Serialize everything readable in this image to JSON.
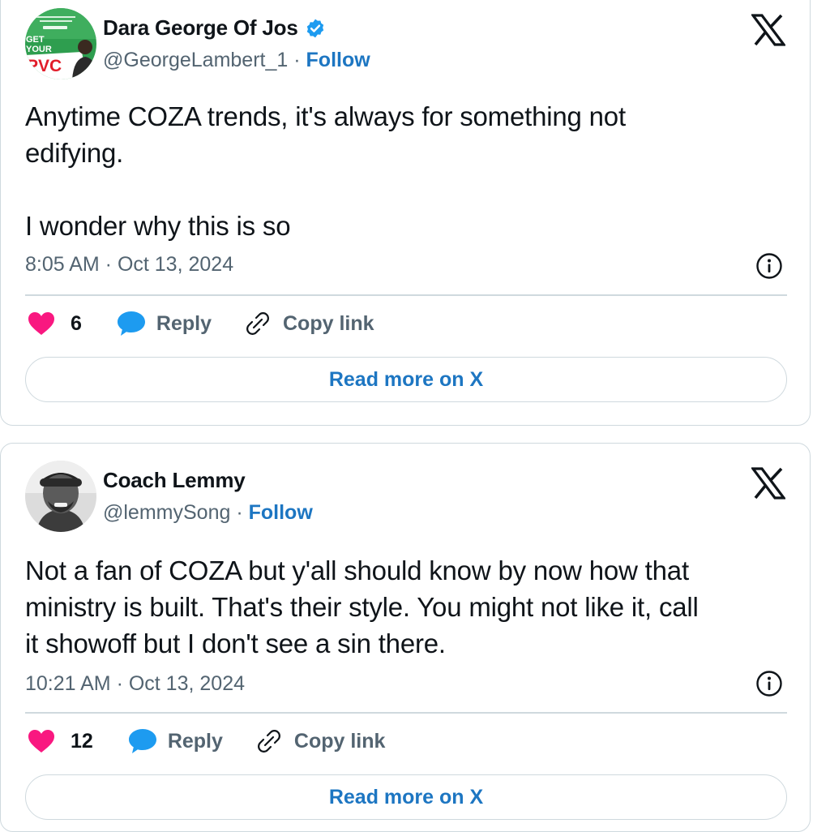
{
  "tweets": [
    {
      "display_name": "Dara George Of Jos",
      "handle": "@GeorgeLambert_1",
      "separator": "·",
      "follow_label": "Follow",
      "verified": true,
      "avatar_text_top": "GET",
      "avatar_text_mid": "YOUR",
      "avatar_text_big": "PVC",
      "text": "Anytime COZA trends, it's always for something not\nedifying.\n\nI wonder why this is so",
      "timestamp": "8:05 AM · Oct 13, 2024",
      "likes": "6",
      "reply_label": "Reply",
      "copy_link_label": "Copy link",
      "read_more_label": "Read more on X"
    },
    {
      "display_name": "Coach Lemmy",
      "handle": "@lemmySong",
      "separator": "·",
      "follow_label": "Follow",
      "verified": false,
      "text": "Not a fan of COZA but y'all should know by now how that\nministry is built. That's their style. You might not like it, call\nit showoff but I don't see a sin there.",
      "timestamp": "10:21 AM · Oct 13, 2024",
      "likes": "12",
      "reply_label": "Reply",
      "copy_link_label": "Copy link",
      "read_more_label": "Read more on X"
    }
  ],
  "colors": {
    "like": "#f91880",
    "reply": "#1d9bf0",
    "link": "#1d76c2",
    "muted": "#536471",
    "border": "#cfd9de",
    "verified": "#1d9bf0"
  },
  "icons": {
    "verified": "verified-badge-icon",
    "x_logo": "x-logo-icon",
    "info": "info-icon",
    "like": "heart-icon",
    "reply": "speech-bubble-icon",
    "copy_link": "link-icon"
  }
}
